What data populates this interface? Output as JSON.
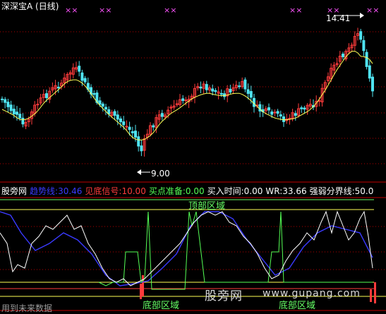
{
  "header": {
    "title": "深深宝A (日线)"
  },
  "markers": {
    "x_symbol": "××"
  },
  "price": {
    "high_label": "14.41",
    "low_label": "9.00"
  },
  "legend": {
    "source": "股旁网",
    "trend_name": "趋势线:",
    "trend_value": "30.46",
    "bottom_signal_name": "见底信号:",
    "bottom_signal_value": "10.00",
    "buy_prep_name": "买点准备:",
    "buy_prep_value": "0.00",
    "buy_time_name": "买入时间:",
    "buy_time_value": "0.00",
    "wr_name": "WR:",
    "wr_value": "33.66",
    "divide_name": "强弱分界线:",
    "divide_value": "50.0"
  },
  "indicator": {
    "top_zone_label": "顶部区域",
    "bottom_zone_label_1": "底部区域",
    "bottom_zone_label_2": "底部区域"
  },
  "watermark": {
    "text": "股旁网",
    "url": "www.gupang.com"
  },
  "footer": {
    "text": "用到未来数据"
  },
  "colors": {
    "up": "#ff3b3b",
    "down": "#4fe3f0",
    "ma": "#ffff55",
    "trend": "#3a3aff",
    "wr": "#ffffff",
    "signal": "#55ff55",
    "marker": "#ff55ff",
    "grid": "#b00000",
    "axis": "#c00000",
    "divider": "#7f7f00"
  }
}
